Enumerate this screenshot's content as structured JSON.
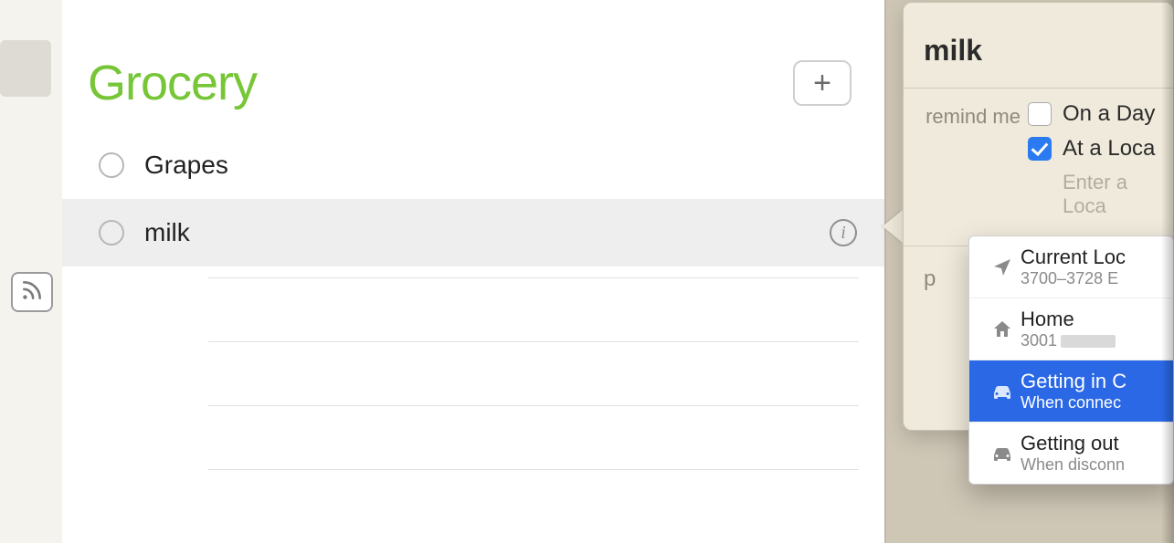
{
  "list": {
    "title": "Grocery",
    "accent_color": "#77c637",
    "items": [
      {
        "label": "Grapes",
        "selected": false
      },
      {
        "label": "milk",
        "selected": true
      }
    ]
  },
  "inspector": {
    "title": "milk",
    "remind_label": "remind me",
    "on_a_day": {
      "label": "On a Day",
      "checked": false
    },
    "at_location": {
      "label": "At a Loca",
      "checked": true
    },
    "location_placeholder": "Enter a Loca",
    "priority_label": "p"
  },
  "suggestions": [
    {
      "icon": "location-arrow",
      "title": "Current Loc",
      "sub": "3700–3728 E",
      "selected": false
    },
    {
      "icon": "home",
      "title": "Home",
      "sub": "3001",
      "selected": false,
      "redacted": true
    },
    {
      "icon": "car",
      "title": "Getting in C",
      "sub": "When connec",
      "selected": true
    },
    {
      "icon": "car",
      "title": "Getting out",
      "sub": "When disconn",
      "selected": false
    }
  ]
}
